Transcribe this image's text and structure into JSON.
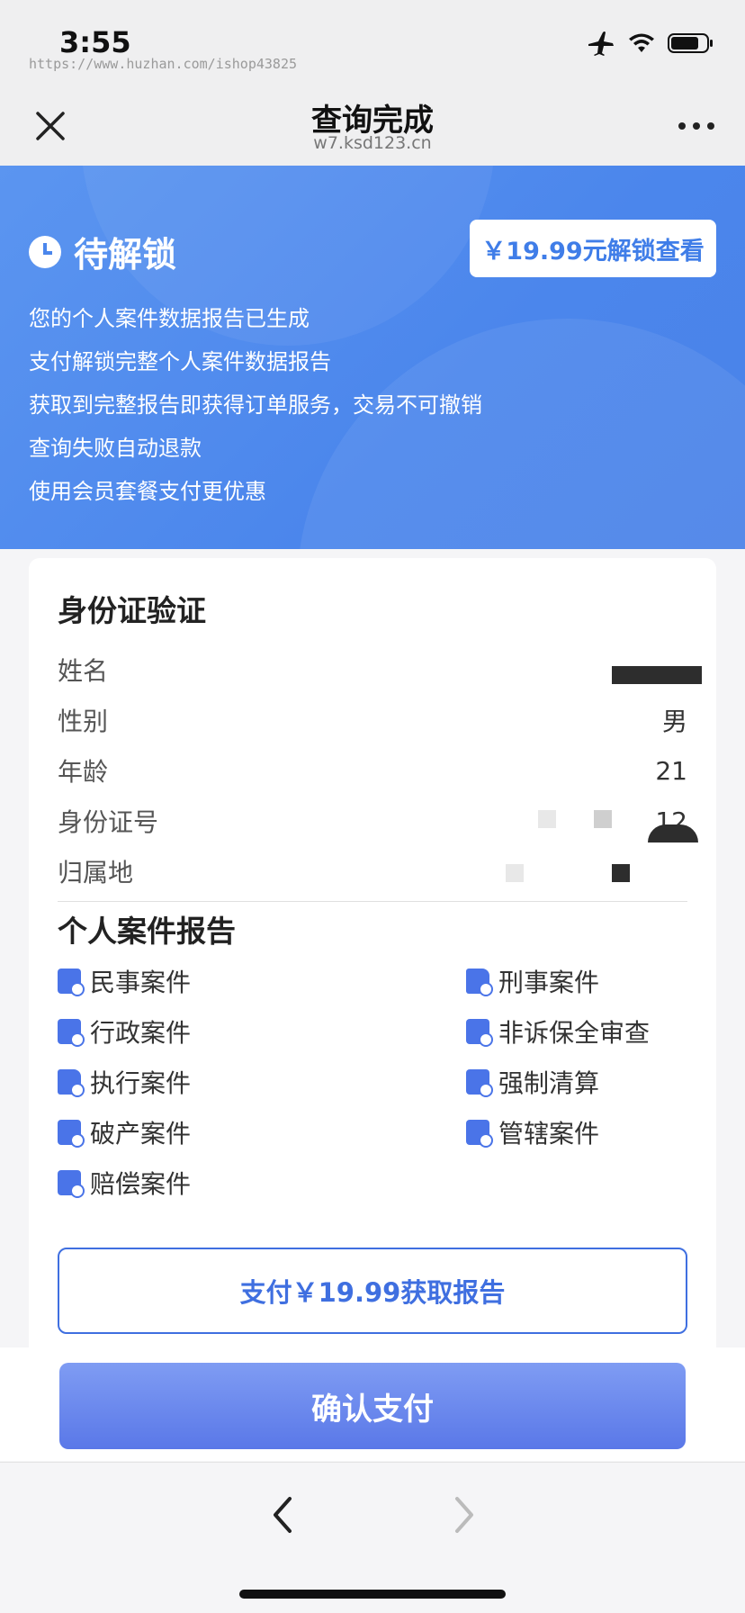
{
  "status_bar": {
    "time": "3:55",
    "watermark": "https://www.huzhan.com/ishop43825",
    "icons": [
      "airplane-icon",
      "wifi-icon",
      "battery-icon"
    ]
  },
  "header": {
    "title": "查询完成",
    "subtitle": "w7.ksd123.cn",
    "close_icon": "close-icon",
    "more_icon": "more-icon"
  },
  "banner": {
    "status": "待解锁",
    "unlock_button": "￥19.99元解锁查看",
    "lines": [
      "您的个人案件数据报告已生成",
      "支付解锁完整个人案件数据报告",
      "获取到完整报告即获得订单服务，交易不可撤销",
      "查询失败自动退款",
      "使用会员套餐支付更优惠"
    ]
  },
  "id_verification": {
    "title": "身份证验证",
    "rows": [
      {
        "label": "姓名",
        "value": ""
      },
      {
        "label": "性别",
        "value": "男"
      },
      {
        "label": "年龄",
        "value": "21"
      },
      {
        "label": "身份证号",
        "value": "12"
      },
      {
        "label": "归属地",
        "value": ""
      }
    ]
  },
  "case_report": {
    "title": "个人案件报告",
    "items": [
      "民事案件",
      "刑事案件",
      "行政案件",
      "非诉保全审查",
      "执行案件",
      "强制清算",
      "破产案件",
      "管辖案件",
      "赔偿案件"
    ],
    "pay_button": "支付￥19.99获取报告"
  },
  "confirm_button": "确认支付",
  "colors": {
    "banner_blue": "#4b86ec",
    "accent_blue": "#3f6fe0",
    "pay_gradient_top": "#7f9cf3",
    "pay_gradient_bottom": "#5a78e8"
  }
}
